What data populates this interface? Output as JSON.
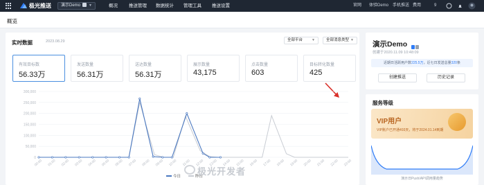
{
  "colors": {
    "topbar": "#1f2733",
    "accent": "#2f7cf6",
    "series_today": "#4a78c0",
    "series_yesterday": "#c8ccd3",
    "arrow": "#d9302a",
    "vip_text": "#b8641f"
  },
  "topbar": {
    "brand": "极光推送",
    "app_select": "演示Demo",
    "nav": [
      "概况",
      "推送管理",
      "数据统计",
      "管理工具",
      "推送设置"
    ],
    "right": [
      "官网",
      "体验Demo",
      "手机推送",
      "费用",
      "9"
    ]
  },
  "page": {
    "title": "概览"
  },
  "realtime": {
    "title": "实时数据",
    "date": "2023.08.29",
    "platform_select": "全部平台",
    "type_select": "全部消息类型",
    "cards": [
      {
        "label": "有效目标数",
        "value": "56.33万"
      },
      {
        "label": "发送数量",
        "value": "56.31万"
      },
      {
        "label": "送达数量",
        "value": "56.31万"
      },
      {
        "label": "展示数量",
        "value": "43,175"
      },
      {
        "label": "点击数量",
        "value": "603"
      },
      {
        "label": "目标转化数量",
        "value": "425"
      }
    ],
    "legend": {
      "today": "今日",
      "yesterday": "昨日"
    }
  },
  "chart_data": {
    "type": "line",
    "y_tick_labels": [
      "300,000",
      "250,000",
      "200,000",
      "150,000",
      "100,000",
      "50,000",
      "0"
    ],
    "ylim": [
      0,
      300000
    ],
    "grid": true,
    "legend_position": "bottom",
    "categories": [
      "00:00",
      "01:00",
      "02:00",
      "03:00",
      "04:00",
      "05:00",
      "06:00",
      "07:00",
      "08:00",
      "09:00",
      "10:00",
      "11:00",
      "12:00",
      "13:00",
      "14:00",
      "15:00",
      "16:00",
      "17:00",
      "18:00",
      "19:00",
      "20:00",
      "21:00",
      "22:00",
      "23:00"
    ],
    "series": [
      {
        "name": "今日",
        "values": [
          0,
          0,
          0,
          0,
          0,
          0,
          0,
          0,
          0,
          0,
          0,
          0,
          0,
          0,
          0,
          0,
          0,
          0,
          0,
          0,
          0,
          0,
          0,
          0
        ]
      },
      {
        "name": "昨日",
        "values": [
          0,
          0,
          0,
          0,
          0,
          0,
          0,
          0,
          0,
          0,
          0,
          0,
          0,
          0,
          0,
          0,
          0,
          0,
          0,
          0,
          0,
          0,
          0,
          0
        ]
      }
    ],
    "today_points": [
      [
        0,
        0
      ],
      [
        1,
        0
      ],
      [
        2,
        0
      ],
      [
        3,
        0
      ],
      [
        4,
        0
      ],
      [
        5,
        0
      ],
      [
        6,
        0
      ],
      [
        6.7,
        0
      ],
      [
        7.5,
        267000
      ],
      [
        8.5,
        3000
      ],
      [
        9.2,
        0
      ],
      [
        9.9,
        0
      ],
      [
        11.0,
        200000
      ],
      [
        12.2,
        18000
      ],
      [
        12.7,
        0
      ],
      [
        13.5,
        0
      ]
    ],
    "yesterday_points": [
      [
        0,
        0
      ],
      [
        1,
        0
      ],
      [
        2,
        0
      ],
      [
        3,
        0
      ],
      [
        4,
        0
      ],
      [
        5,
        0
      ],
      [
        6,
        0
      ],
      [
        6.7,
        0
      ],
      [
        7.5,
        250000
      ],
      [
        8.6,
        12000
      ],
      [
        9.3,
        0
      ],
      [
        10,
        0
      ],
      [
        10.9,
        188000
      ],
      [
        12.0,
        30000
      ],
      [
        12.7,
        3000
      ],
      [
        13.3,
        0
      ],
      [
        14,
        0
      ],
      [
        15,
        0
      ],
      [
        16,
        0
      ],
      [
        16.6,
        0
      ],
      [
        17.3,
        190000
      ],
      [
        18.4,
        16000
      ],
      [
        19,
        0
      ],
      [
        20,
        0
      ],
      [
        21,
        0
      ],
      [
        22,
        0
      ],
      [
        23,
        0
      ]
    ]
  },
  "app": {
    "name": "演示Demo",
    "created": "创建于2020.11.09 10:48:09",
    "notice_parts": [
      "近期日活跃用户数",
      "225.5万",
      "，近七日发送总量",
      "320",
      "条"
    ],
    "buttons": [
      "创建推送",
      "历史记录"
    ]
  },
  "service": {
    "title": "服务等级",
    "vip_title": "VIP用户",
    "vip_desc": "VIP账户已开通493天，将于2024.01.14到期",
    "caption": "演示日Push/API调用量趋势"
  },
  "watermark": "极光开发者"
}
